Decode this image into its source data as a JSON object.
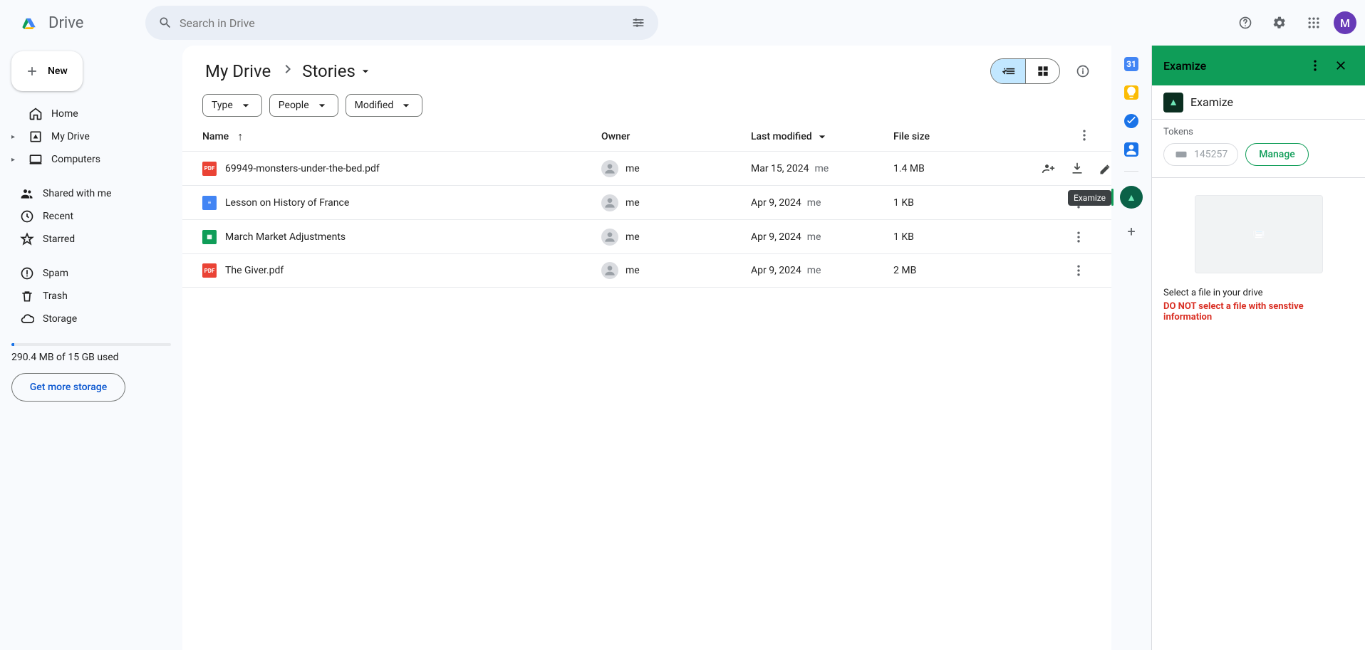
{
  "app": {
    "title": "Drive"
  },
  "search": {
    "placeholder": "Search in Drive"
  },
  "avatar": {
    "initial": "M"
  },
  "newButton": {
    "label": "New"
  },
  "nav": {
    "home": "Home",
    "myDrive": "My Drive",
    "computers": "Computers",
    "shared": "Shared with me",
    "recent": "Recent",
    "starred": "Starred",
    "spam": "Spam",
    "trash": "Trash",
    "storage": "Storage"
  },
  "storage": {
    "usageText": "290.4 MB of 15 GB used",
    "moreBtn": "Get more storage"
  },
  "breadcrumb": {
    "root": "My Drive",
    "current": "Stories"
  },
  "filters": {
    "type": "Type",
    "people": "People",
    "modified": "Modified"
  },
  "columns": {
    "name": "Name",
    "owner": "Owner",
    "modified": "Last modified",
    "size": "File size"
  },
  "files": [
    {
      "icon": "pdf",
      "name": "69949-monsters-under-the-bed.pdf",
      "owner": "me",
      "modified": "Mar 15, 2024",
      "modBy": "me",
      "size": "1.4 MB",
      "selected": true
    },
    {
      "icon": "doc",
      "name": "Lesson on History of France",
      "owner": "me",
      "modified": "Apr 9, 2024",
      "modBy": "me",
      "size": "1 KB",
      "selected": false
    },
    {
      "icon": "sheet",
      "name": "March Market Adjustments",
      "owner": "me",
      "modified": "Apr 9, 2024",
      "modBy": "me",
      "size": "1 KB",
      "selected": false
    },
    {
      "icon": "pdf",
      "name": "The Giver.pdf",
      "owner": "me",
      "modified": "Apr 9, 2024",
      "modBy": "me",
      "size": "2 MB",
      "selected": false
    }
  ],
  "sidecol": {
    "tooltip": "Examize"
  },
  "examize": {
    "headTitle": "Examize",
    "subTitle": "Examize",
    "tokensLabel": "Tokens",
    "tokensValue": "145257",
    "manage": "Manage",
    "line1": "Select a file in your drive",
    "line2": "DO NOT select a file with senstive information"
  }
}
